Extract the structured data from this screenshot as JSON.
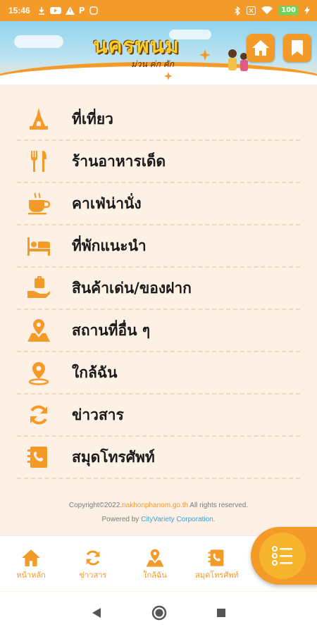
{
  "status_bar": {
    "time": "15:46",
    "left_icons": [
      "download-icon",
      "youtube-icon",
      "alert-icon",
      "parking-icon",
      "app-icon"
    ],
    "right_icons": [
      "bluetooth-icon",
      "close-box-icon",
      "wifi-icon"
    ],
    "battery": "100"
  },
  "header": {
    "logo_title": "นครพนม",
    "logo_sub": "ม่วน ค่ก คัก"
  },
  "menu": {
    "items": [
      {
        "label": "ที่เที่ยว",
        "icon": "temple-icon"
      },
      {
        "label": "ร้านอาหารเด็ด",
        "icon": "utensils-icon"
      },
      {
        "label": "คาเฟ่น่านั่ง",
        "icon": "coffee-icon"
      },
      {
        "label": "ที่พักแนะนำ",
        "icon": "bed-icon"
      },
      {
        "label": "สินค้าเด่น/ของฝาก",
        "icon": "gift-hand-icon"
      },
      {
        "label": "สถานที่อื่น ๆ",
        "icon": "map-pin-icon"
      },
      {
        "label": "ใกล้ฉัน",
        "icon": "location-icon"
      },
      {
        "label": "ข่าวสาร",
        "icon": "refresh-icon"
      },
      {
        "label": "สมุดโทรศัพท์",
        "icon": "phonebook-icon"
      }
    ]
  },
  "footer": {
    "copyright_pre": "Copyright©2022.",
    "copyright_site": "nakhonphanom.go.th",
    "copyright_post": " All rights reserved.",
    "powered_pre": "Powered by ",
    "powered_by": "CityVariety Corporation."
  },
  "bottom_nav": {
    "items": [
      {
        "label": "หน้าหลัก",
        "icon": "home-icon"
      },
      {
        "label": "ข่าวสาร",
        "icon": "refresh-icon"
      },
      {
        "label": "ใกล้ฉัน",
        "icon": "map-pin-icon"
      },
      {
        "label": "สมุดโทรศัพท์",
        "icon": "phonebook-icon"
      }
    ]
  },
  "colors": {
    "accent": "#f39a29",
    "background": "#fdf0e4"
  }
}
